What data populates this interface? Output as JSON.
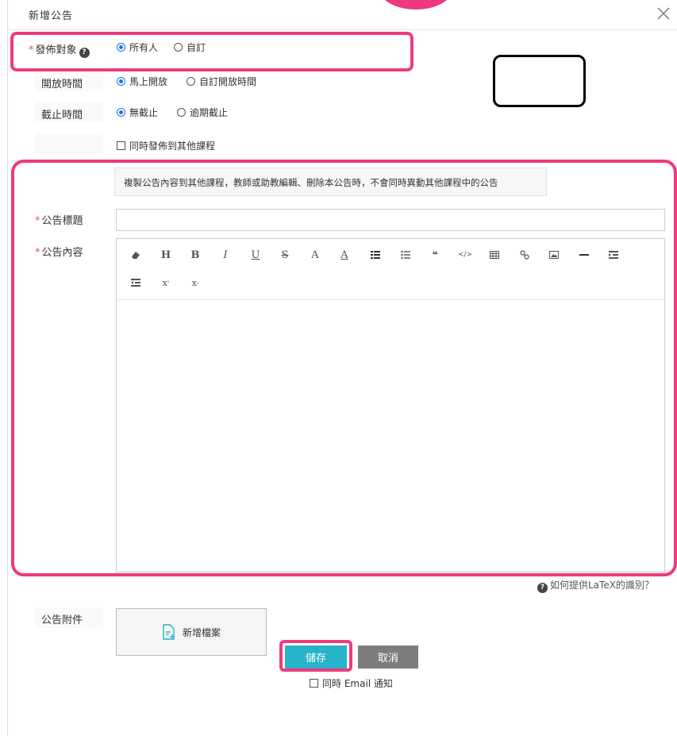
{
  "dialog": {
    "title": "新增公告",
    "close_icon": "close-icon"
  },
  "audience": {
    "label": "發佈對象",
    "required_mark": "*",
    "help_icon": "question-circle-icon",
    "options": [
      "所有人",
      "自訂"
    ],
    "selected": "所有人"
  },
  "open_time": {
    "label": "開放時間",
    "options": [
      "馬上開放",
      "自訂開放時間"
    ],
    "selected": "馬上開放"
  },
  "deadline": {
    "label": "截止時間",
    "options": [
      "無截止",
      "逾期截止"
    ],
    "selected": "無截止"
  },
  "publish_other": {
    "label": "同時發佈到其他課程",
    "checked": false
  },
  "notice": {
    "text": "複製公告內容到其他課程，教師或助教編輯、刪除本公告時，不會同時異動其他課程中的公告"
  },
  "title_field": {
    "label": "公告標題",
    "required_mark": "*",
    "value": ""
  },
  "content_field": {
    "label": "公告內容",
    "required_mark": "*",
    "toolbar": {
      "row1": [
        "eraser-icon",
        "H",
        "B",
        "I",
        "U",
        "S",
        "A",
        "A",
        "ordered-list-icon",
        "bullet-list-icon",
        "quote-icon",
        "code-icon",
        "table-icon",
        "link-icon",
        "image-icon",
        "horizontal-rule-icon",
        "indent-icon"
      ],
      "row2": [
        "outdent-icon",
        "superscript-icon",
        "subscript-icon"
      ],
      "row1_text": [
        "",
        "H",
        "B",
        "I",
        "U",
        "S",
        "A",
        "A",
        "",
        "",
        "❝",
        "</>",
        "",
        "",
        "",
        "",
        ""
      ]
    },
    "value": ""
  },
  "latex_help": {
    "text": "如何提供LaTeX的識別？"
  },
  "attachment": {
    "label": "公告附件",
    "button_label": "新增檔案"
  },
  "email_notify": {
    "label": "同時 Email 通知",
    "checked": false
  },
  "actions": {
    "save": "儲存",
    "cancel": "取消"
  },
  "colors": {
    "accent": "#27b3c9",
    "highlight": "#f0387f",
    "radio_selected": "#1a73e8",
    "cancel": "#7d7d7d"
  }
}
